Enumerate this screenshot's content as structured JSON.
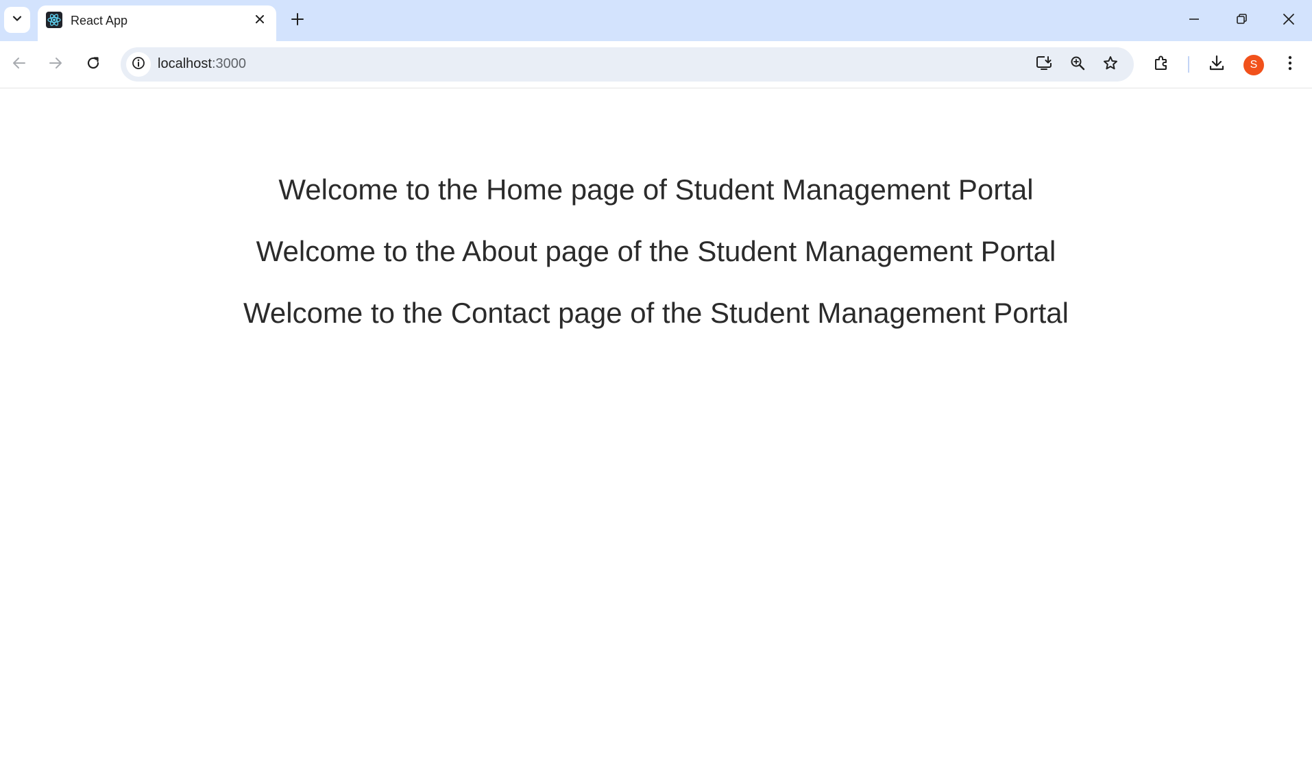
{
  "browser": {
    "tab": {
      "title": "React App",
      "favicon": "react-icon"
    },
    "address_bar": {
      "host": "localhost",
      "port": ":3000"
    },
    "profile_initial": "S",
    "colors": {
      "tabstrip_bg": "#d3e3fd",
      "omnibox_bg": "#e9eef6",
      "avatar_bg": "#f1511b"
    },
    "icons": [
      "tab-search-icon",
      "close-icon",
      "plus-icon",
      "minimize-icon",
      "restore-icon",
      "back-icon",
      "forward-icon",
      "reload-icon",
      "info-icon",
      "install-app-icon",
      "zoom-icon",
      "star-icon",
      "extensions-icon",
      "download-icon",
      "more-icon"
    ]
  },
  "page": {
    "headings": [
      "Welcome to the Home page of Student Management Portal",
      "Welcome to the About page of the Student Management Portal",
      "Welcome to the Contact page of the Student Management Portal"
    ]
  }
}
